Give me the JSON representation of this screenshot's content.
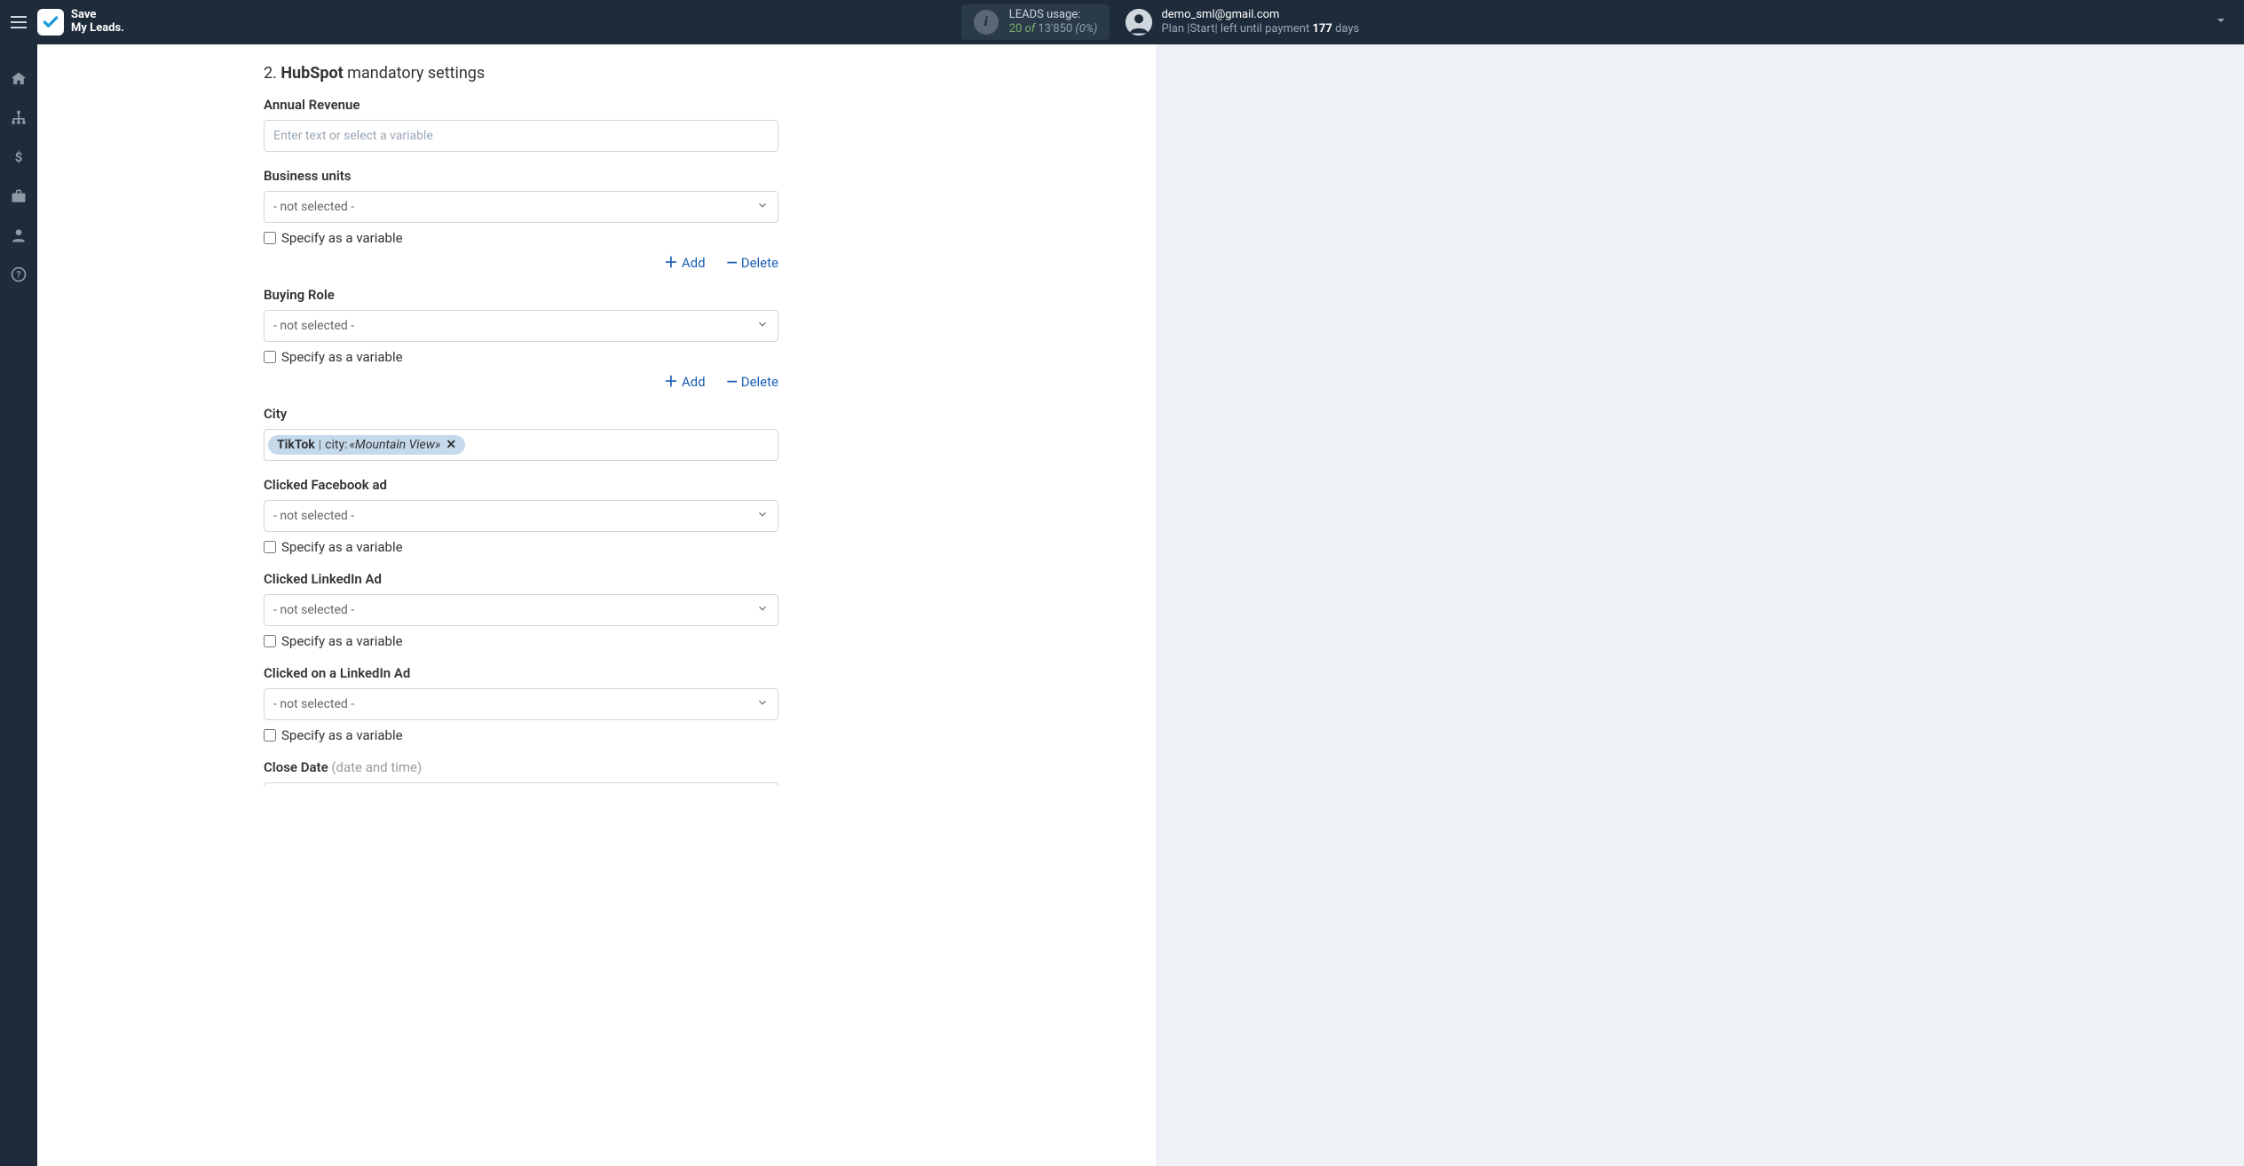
{
  "header": {
    "logo_line1": "Save",
    "logo_line2": "My Leads.",
    "usage_label": "LEADS usage:",
    "usage_used": "20",
    "usage_of": "of",
    "usage_total": "13'850",
    "usage_pct": "(0%)",
    "account_email": "demo_sml@gmail.com",
    "plan_pre": "Plan |Start| left until payment ",
    "plan_days": "177",
    "plan_post": " days"
  },
  "section": {
    "num": "2.",
    "bold": "HubSpot",
    "rest": " mandatory settings"
  },
  "labels": {
    "specify": "Specify as a variable",
    "add": "Add",
    "delete": "Delete",
    "not_selected": "- not selected -",
    "placeholder": "Enter text or select a variable"
  },
  "fields": {
    "annual_revenue": {
      "label": "Annual Revenue"
    },
    "business_units": {
      "label": "Business units"
    },
    "buying_role": {
      "label": "Buying Role"
    },
    "city": {
      "label": "City",
      "tag_source": "TikTok",
      "tag_key": "city:",
      "tag_value": "«Mountain View»"
    },
    "clicked_fb": {
      "label": "Clicked Facebook ad"
    },
    "clicked_li": {
      "label": "Clicked LinkedIn Ad"
    },
    "clicked_on_li": {
      "label": "Clicked on a LinkedIn Ad"
    },
    "close_date": {
      "label": "Close Date ",
      "hint": "(date and time)"
    }
  }
}
